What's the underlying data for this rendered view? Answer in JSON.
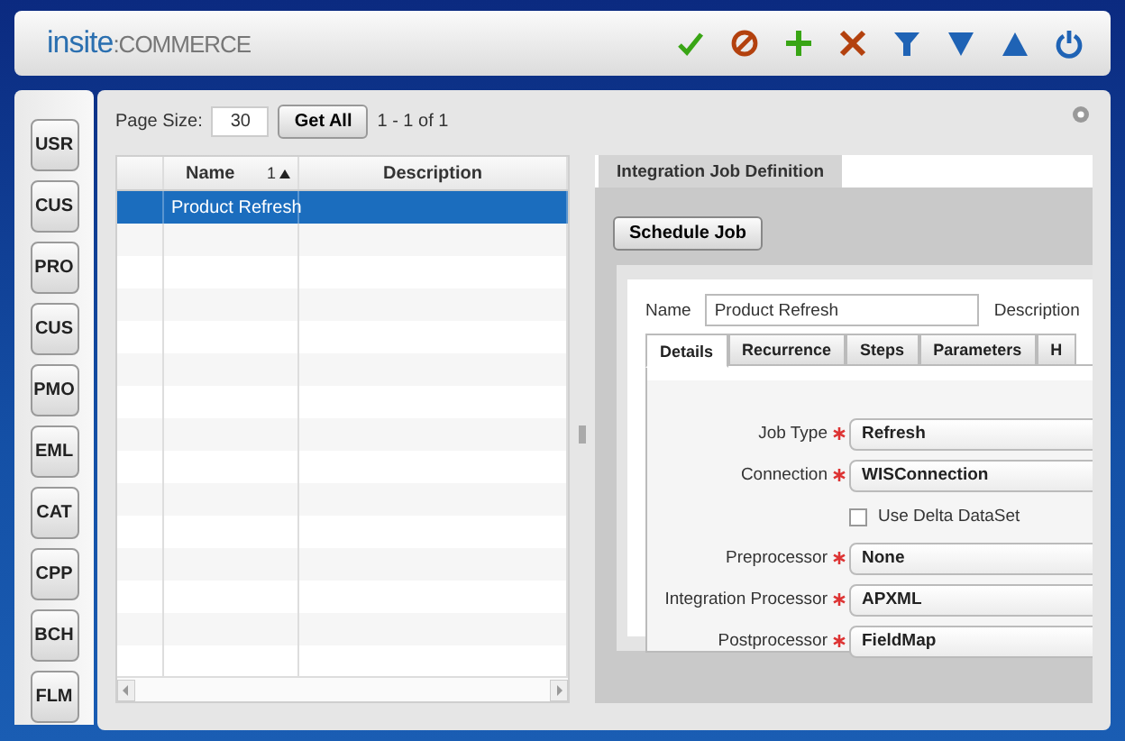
{
  "header": {
    "logo_brand": "insite",
    "logo_product": ":COMMERCE"
  },
  "sidebar": {
    "items": [
      {
        "label": "USR"
      },
      {
        "label": "CUS"
      },
      {
        "label": "PRO"
      },
      {
        "label": "CUS"
      },
      {
        "label": "PMO"
      },
      {
        "label": "EML"
      },
      {
        "label": "CAT"
      },
      {
        "label": "CPP"
      },
      {
        "label": "BCH"
      },
      {
        "label": "FLM"
      }
    ]
  },
  "list": {
    "page_size_label": "Page Size:",
    "page_size": "30",
    "get_all": "Get All",
    "range": "1 - 1 of 1",
    "columns": [
      {
        "label": "Name",
        "sort_order": "1",
        "sort_ascending": true
      },
      {
        "label": "Description"
      }
    ],
    "rows": [
      {
        "name": "Product Refresh",
        "selected": true
      }
    ]
  },
  "editor": {
    "tab": "Integration Job Definition",
    "schedule_button": "Schedule Job",
    "name_label": "Name",
    "name_value": "Product Refresh",
    "description_label": "Description",
    "tabs": [
      {
        "label": "Details",
        "selected": true
      },
      {
        "label": "Recurrence",
        "selected": false
      },
      {
        "label": "Steps",
        "selected": false
      },
      {
        "label": "Parameters",
        "selected": false
      },
      {
        "label": "H",
        "selected": false
      }
    ],
    "fields": [
      {
        "kind": "select",
        "label": "Job Type",
        "required": true,
        "value": "Refresh"
      },
      {
        "kind": "select",
        "label": "Connection",
        "required": true,
        "value": "WISConnection"
      },
      {
        "kind": "checkbox",
        "label": "Use Delta DataSet",
        "checked": false
      },
      {
        "kind": "select",
        "label": "Preprocessor",
        "required": true,
        "value": "None"
      },
      {
        "kind": "select",
        "label": "Integration Processor",
        "required": true,
        "value": "APXML"
      },
      {
        "kind": "select",
        "label": "Postprocessor",
        "required": true,
        "value": "FieldMap"
      }
    ]
  }
}
